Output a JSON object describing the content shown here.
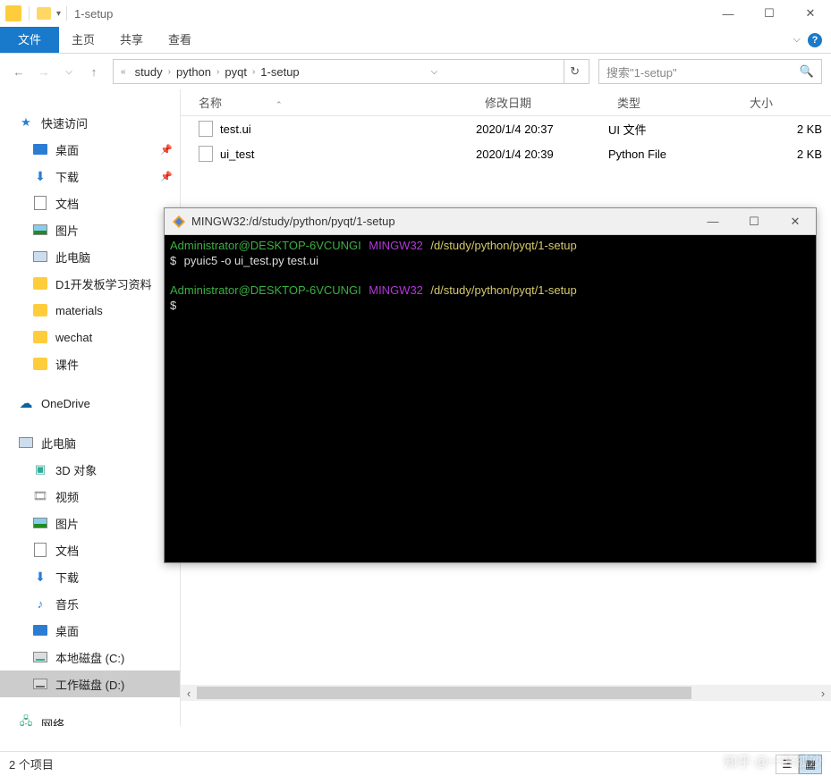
{
  "window": {
    "title": "1-setup"
  },
  "ribbon": {
    "file": "文件",
    "home": "主页",
    "share": "共享",
    "view": "查看"
  },
  "nav": {
    "crumbs": [
      "study",
      "python",
      "pyqt",
      "1-setup"
    ],
    "search_placeholder": "搜索\"1-setup\""
  },
  "sidebar": {
    "quick": {
      "label": "快速访问",
      "items": [
        {
          "label": "桌面",
          "ico": "desktop",
          "pinned": true
        },
        {
          "label": "下载",
          "ico": "download",
          "pinned": true
        },
        {
          "label": "文档",
          "ico": "doc"
        },
        {
          "label": "图片",
          "ico": "pic"
        },
        {
          "label": "此电脑",
          "ico": "pc"
        },
        {
          "label": "D1开发板学习资料",
          "ico": "folder"
        },
        {
          "label": "materials",
          "ico": "folder"
        },
        {
          "label": "wechat",
          "ico": "folder"
        },
        {
          "label": "课件",
          "ico": "folder"
        }
      ]
    },
    "onedrive": "OneDrive",
    "pc": {
      "label": "此电脑",
      "items": [
        {
          "label": "3D 对象",
          "ico": "3d"
        },
        {
          "label": "视频",
          "ico": "video"
        },
        {
          "label": "图片",
          "ico": "pic"
        },
        {
          "label": "文档",
          "ico": "doc"
        },
        {
          "label": "下载",
          "ico": "download"
        },
        {
          "label": "音乐",
          "ico": "music"
        },
        {
          "label": "桌面",
          "ico": "desktop"
        },
        {
          "label": "本地磁盘 (C:)",
          "ico": "drive-c"
        },
        {
          "label": "工作磁盘 (D:)",
          "ico": "drive-d",
          "selected": true
        }
      ]
    },
    "network": "网络"
  },
  "columns": {
    "name": "名称",
    "date": "修改日期",
    "type": "类型",
    "size": "大小"
  },
  "files": [
    {
      "name": "test.ui",
      "date": "2020/1/4 20:37",
      "type": "UI 文件",
      "size": "2 KB",
      "ico": "ui"
    },
    {
      "name": "ui_test",
      "date": "2020/1/4 20:39",
      "type": "Python File",
      "size": "2 KB",
      "ico": "py"
    }
  ],
  "terminal": {
    "title": "MINGW32:/d/study/python/pyqt/1-setup",
    "user": "Administrator@DESKTOP-6VCUNGI",
    "host": "MINGW32",
    "path": "/d/study/python/pyqt/1-setup",
    "command": "pyuic5 -o ui_test.py test.ui",
    "prompt": "$"
  },
  "status": {
    "count": "2 个项目"
  },
  "watermark": "知乎 @一叶孤沙"
}
